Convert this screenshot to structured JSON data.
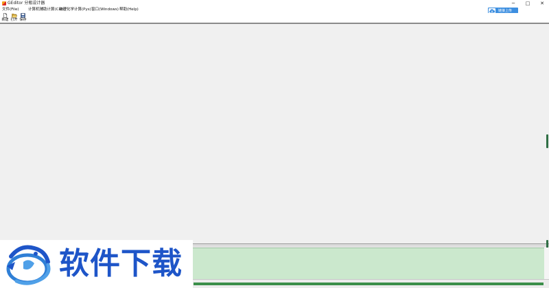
{
  "window": {
    "title": "GEditor 分瓶设计器",
    "controls": {
      "minimize": "─",
      "maximize": "□",
      "close": "✕"
    }
  },
  "menu": {
    "file": "文件(File)",
    "calc": "计算机辅助计算(Calc)",
    "phys": "物理化学计算(Pys)",
    "windows": "窗口(Windows)",
    "help": "帮助(Help)"
  },
  "cloud_button": {
    "label": "链接上传",
    "icon": "cloud-upload-icon",
    "color": "#3d8fe0"
  },
  "toolbar": {
    "new": {
      "label": "新建",
      "icon": "new-file-icon"
    },
    "open": {
      "label": "打开",
      "icon": "open-folder-icon"
    },
    "save": {
      "label": "保存",
      "icon": "save-disk-icon"
    }
  },
  "output_panel": {
    "color": "#cbe8cd"
  },
  "status": {
    "progress": 1.0,
    "progress_color": "#3b8f4a"
  },
  "watermark": {
    "text": "软件下载",
    "icon": "dragon-logo-icon",
    "color": "#1e55c8"
  }
}
